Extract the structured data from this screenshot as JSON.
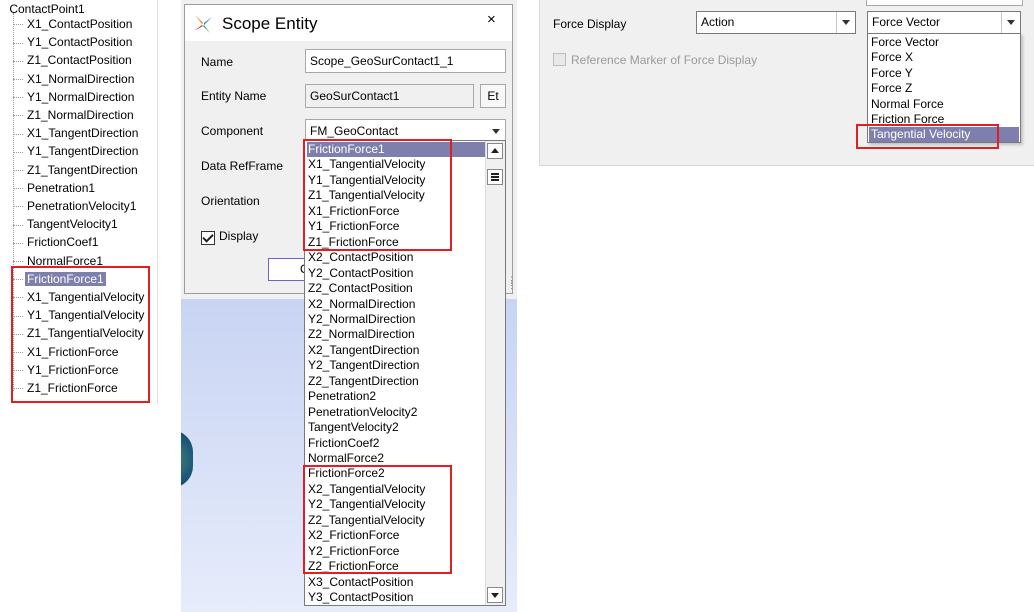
{
  "tree": {
    "root": "ContactPoint1",
    "items": [
      "X1_ContactPosition",
      "Y1_ContactPosition",
      "Z1_ContactPosition",
      "X1_NormalDirection",
      "Y1_NormalDirection",
      "Z1_NormalDirection",
      "X1_TangentDirection",
      "Y1_TangentDirection",
      "Z1_TangentDirection",
      "Penetration1",
      "PenetrationVelocity1",
      "TangentVelocity1",
      "FrictionCoef1",
      "NormalForce1",
      "FrictionForce1",
      "X1_TangentialVelocity",
      "Y1_TangentialVelocity",
      "Z1_TangentialVelocity",
      "X1_FrictionForce",
      "Y1_FrictionForce",
      "Z1_FrictionForce"
    ],
    "selected_index": 14
  },
  "dialog": {
    "title": "Scope Entity",
    "close_glyph": "×",
    "name_label": "Name",
    "name_value": "Scope_GeoSurContact1_1",
    "entity_label": "Entity Name",
    "entity_value": "GeoSurContact1",
    "et_button": "Et",
    "component_label": "Component",
    "component_value": "FM_GeoContact",
    "refframe_label": "Data RefFrame",
    "orientation_label": "Orientation",
    "display_label": "Display",
    "ok_partial": "C",
    "dropdown_items": [
      "FrictionForce1",
      "X1_TangentialVelocity",
      "Y1_TangentialVelocity",
      "Z1_TangentialVelocity",
      "X1_FrictionForce",
      "Y1_FrictionForce",
      "Z1_FrictionForce",
      "X2_ContactPosition",
      "Y2_ContactPosition",
      "Z2_ContactPosition",
      "X2_NormalDirection",
      "Y2_NormalDirection",
      "Z2_NormalDirection",
      "X2_TangentDirection",
      "Y2_TangentDirection",
      "Z2_TangentDirection",
      "Penetration2",
      "PenetrationVelocity2",
      "TangentVelocity2",
      "FrictionCoef2",
      "NormalForce2",
      "FrictionForce2",
      "X2_TangentialVelocity",
      "Y2_TangentialVelocity",
      "Z2_TangentialVelocity",
      "X2_FrictionForce",
      "Y2_FrictionForce",
      "Z2_FrictionForce",
      "X3_ContactPosition",
      "Y3_ContactPosition"
    ],
    "dropdown_selected_index": 0
  },
  "force": {
    "label": "Force Display",
    "action_value": "Action",
    "type_value": "Force Vector",
    "checkbox_label": "Reference Marker of Force Display",
    "dropdown_items": [
      "Force Vector",
      "Force X",
      "Force Y",
      "Force Z",
      "Normal Force",
      "Friction Force",
      "Tangential Velocity"
    ],
    "dropdown_selected_index": 6
  },
  "colors": {
    "selection": "#7f7fae",
    "highlight_box": "#e02020"
  },
  "icons": {
    "dialog_title": "cross-star-logo-icon",
    "close": "close-icon",
    "combo": "chevron-down-icon",
    "scroll_up": "scroll-up-icon",
    "scroll_down": "scroll-down-icon",
    "scroll_thumb": "scroll-thumb-grip-icon"
  }
}
